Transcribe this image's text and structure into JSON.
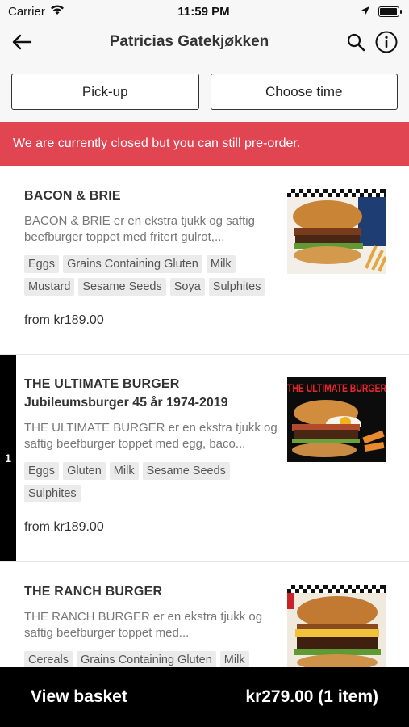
{
  "status_bar": {
    "carrier": "Carrier",
    "time": "11:59 PM",
    "battery_level": 0.95
  },
  "nav": {
    "title": "Patricias Gatekjøkken"
  },
  "options": {
    "pickup_label": "Pick-up",
    "time_label": "Choose time"
  },
  "banner": {
    "text": "We are currently closed but you can still pre-order."
  },
  "menu_items": [
    {
      "name": "BACON & BRIE",
      "subtitle": "",
      "description": "BACON & BRIE er en ekstra tjukk og saftig beefburger toppet med fritert gulrot,...",
      "allergens": [
        "Eggs",
        "Grains Containing Gluten",
        "Milk",
        "Mustard",
        "Sesame Seeds",
        "Soya",
        "Sulphites"
      ],
      "price": "from kr189.00",
      "in_basket": ""
    },
    {
      "name": "THE ULTIMATE BURGER",
      "subtitle": "Jubileumsburger 45 år 1974-2019",
      "description": "THE ULTIMATE BURGER er en ekstra tjukk og saftig beefburger toppet med egg, baco...",
      "allergens": [
        "Eggs",
        "Gluten",
        "Milk",
        "Sesame Seeds",
        "Sulphites"
      ],
      "price": "from kr189.00",
      "in_basket": "1",
      "image_banner_text": "THE ULTIMATE BURGER"
    },
    {
      "name": "THE RANCH BURGER",
      "subtitle": "",
      "description": "THE RANCH BURGER er en ekstra tjukk og saftig beefburger toppet med...",
      "allergens": [
        "Cereals",
        "Grains Containing Gluten",
        "Milk"
      ],
      "price": "",
      "in_basket": ""
    }
  ],
  "basket": {
    "label": "View basket",
    "summary": "kr279.00 (1 item)"
  },
  "colors": {
    "banner": "#e24552",
    "basket_bar": "#000000"
  }
}
